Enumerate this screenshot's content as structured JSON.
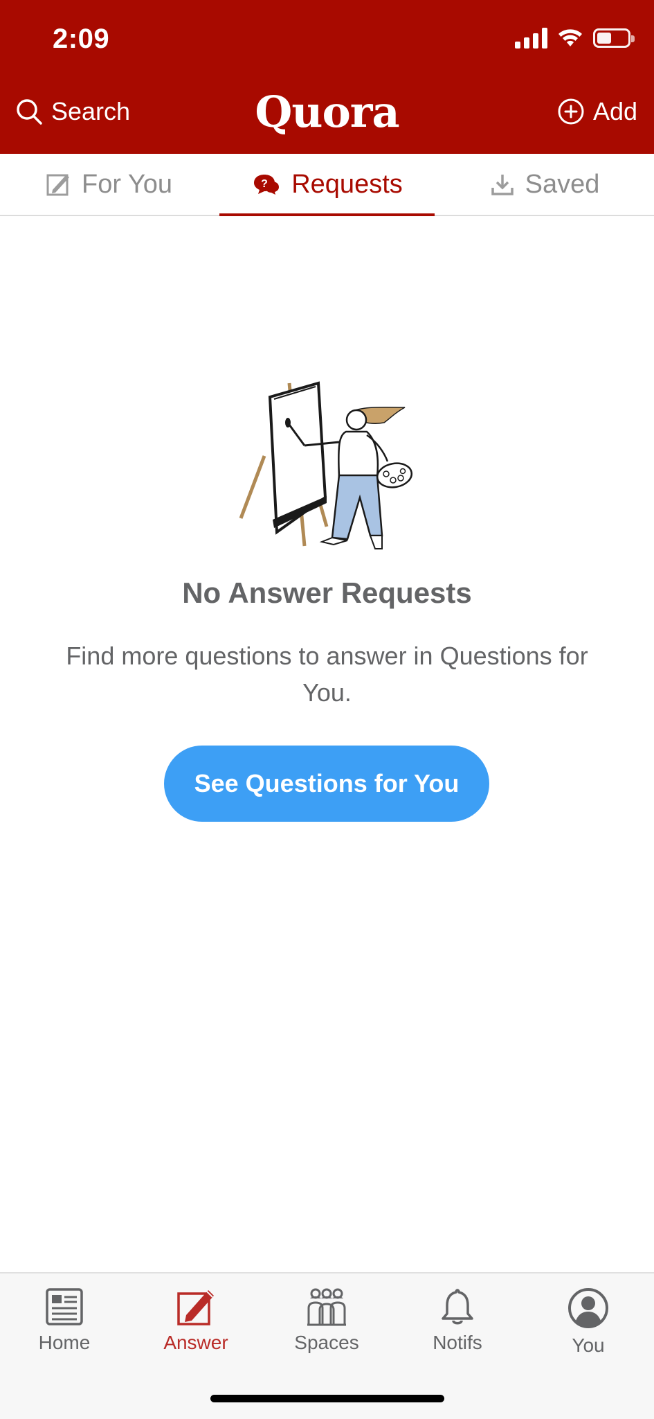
{
  "status_bar": {
    "time": "2:09"
  },
  "header": {
    "search_label": "Search",
    "logo_text": "Quora",
    "add_label": "Add",
    "bg_color": "#a80a00"
  },
  "tabs": [
    {
      "label": "For You",
      "icon": "edit-icon",
      "active": false
    },
    {
      "label": "Requests",
      "icon": "chat-question-icon",
      "active": true
    },
    {
      "label": "Saved",
      "icon": "download-icon",
      "active": false
    }
  ],
  "empty_state": {
    "title": "No Answer Requests",
    "message": "Find more questions to answer in Questions for You.",
    "button_label": "See Questions for You",
    "button_color": "#3d9ff5"
  },
  "bottom_nav": [
    {
      "label": "Home",
      "icon": "home-feed-icon",
      "active": false
    },
    {
      "label": "Answer",
      "icon": "answer-pencil-icon",
      "active": true
    },
    {
      "label": "Spaces",
      "icon": "spaces-people-icon",
      "active": false
    },
    {
      "label": "Notifs",
      "icon": "bell-icon",
      "active": false
    },
    {
      "label": "You",
      "icon": "profile-icon",
      "active": false
    }
  ]
}
